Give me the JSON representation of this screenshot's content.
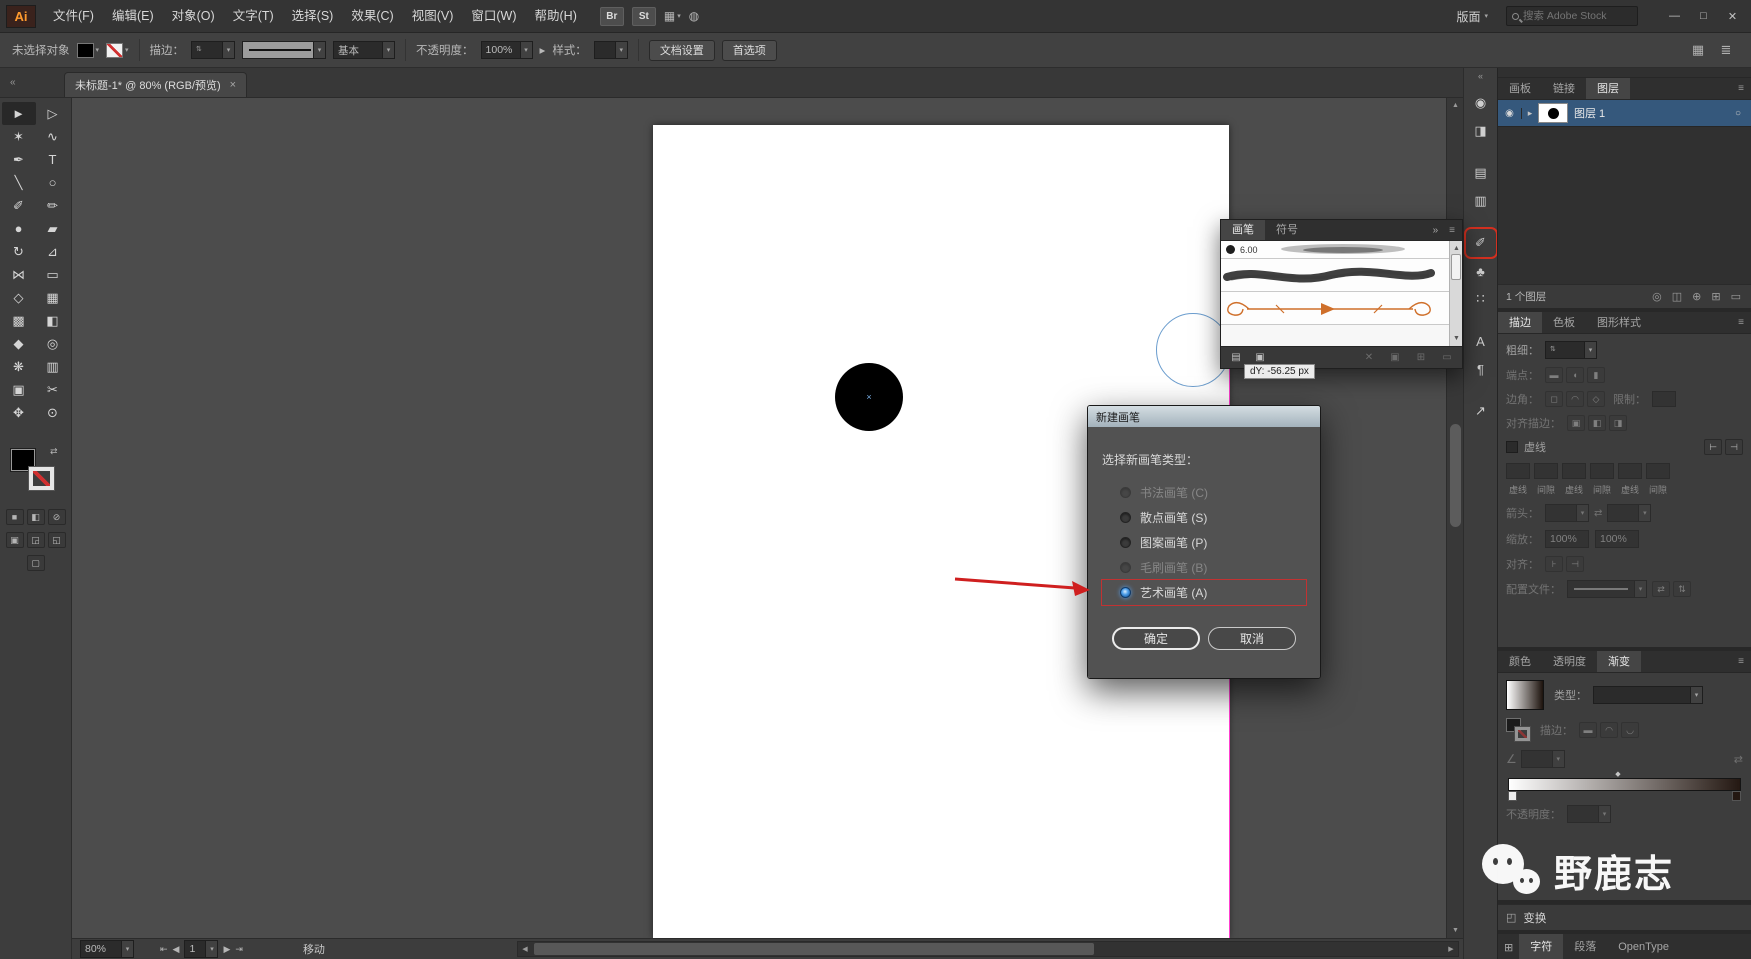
{
  "ui": {
    "caret": "▾",
    "stepper": "⇅",
    "swap": "⇄",
    "arrow_right": "▸",
    "tri_up": "▲",
    "tri_down": "▼",
    "tri_left": "◀",
    "tri_right": "▶"
  },
  "menubar": {
    "logo": "Ai",
    "items": [
      "文件(F)",
      "编辑(E)",
      "对象(O)",
      "文字(T)",
      "选择(S)",
      "效果(C)",
      "视图(V)",
      "窗口(W)",
      "帮助(H)"
    ],
    "br_label": "Br",
    "st_label": "St",
    "arrange_icon": "▦",
    "sync_icon": "◍",
    "layout_label": "版面",
    "search_placeholder": "搜索 Adobe Stock",
    "window_controls": {
      "minimize": "—",
      "maximize": "□",
      "close": "✕"
    }
  },
  "controlbar": {
    "no_selection": "未选择对象",
    "stroke_label": "描边：",
    "brush_def": "基本",
    "opacity_label": "不透明度：",
    "opacity_value": "100%",
    "style_label": "样式：",
    "doc_setup": "文档设置",
    "preferences": "首选项",
    "right_icons": [
      {
        "name": "arrange-documents-icon",
        "glyph": "▦"
      },
      {
        "name": "workspace-menu-icon",
        "glyph": "≣"
      }
    ]
  },
  "tabbar": {
    "collapse": "«",
    "doc_title": "未标题-1* @ 80% (RGB/预览)",
    "close": "×"
  },
  "toolbar": {
    "tools": [
      {
        "name": "selection-tool",
        "glyph": "►",
        "selected": true
      },
      {
        "name": "direct-selection-tool",
        "glyph": "▷"
      },
      {
        "name": "magic-wand-tool",
        "glyph": "✶"
      },
      {
        "name": "lasso-tool",
        "glyph": "∿"
      },
      {
        "name": "pen-tool",
        "glyph": "✒"
      },
      {
        "name": "type-tool",
        "glyph": "T"
      },
      {
        "name": "line-segment-tool",
        "glyph": "╲"
      },
      {
        "name": "ellipse-tool",
        "glyph": "○"
      },
      {
        "name": "paintbrush-tool",
        "glyph": "✐"
      },
      {
        "name": "pencil-tool",
        "glyph": "✏"
      },
      {
        "name": "blob-brush-tool",
        "glyph": "●"
      },
      {
        "name": "eraser-tool",
        "glyph": "▰"
      },
      {
        "name": "rotate-tool",
        "glyph": "↻"
      },
      {
        "name": "scale-tool",
        "glyph": "⊿"
      },
      {
        "name": "width-tool",
        "glyph": "⋈"
      },
      {
        "name": "free-transform-tool",
        "glyph": "▭"
      },
      {
        "name": "shape-builder-tool",
        "glyph": "◇"
      },
      {
        "name": "perspective-grid-tool",
        "glyph": "▦"
      },
      {
        "name": "mesh-tool",
        "glyph": "▩"
      },
      {
        "name": "gradient-tool",
        "glyph": "◧"
      },
      {
        "name": "eyedropper-tool",
        "glyph": "◆"
      },
      {
        "name": "blend-tool",
        "glyph": "◎"
      },
      {
        "name": "symbol-sprayer-tool",
        "glyph": "❋"
      },
      {
        "name": "column-graph-tool",
        "glyph": "▥"
      },
      {
        "name": "artboard-tool",
        "glyph": "▣"
      },
      {
        "name": "slice-tool",
        "glyph": "✂"
      },
      {
        "name": "hand-tool",
        "glyph": "✥"
      },
      {
        "name": "zoom-tool",
        "glyph": "⊙"
      }
    ],
    "swatch_icons": [
      {
        "name": "color-mode-icon",
        "glyph": "■"
      },
      {
        "name": "gradient-mode-icon",
        "glyph": "◧"
      },
      {
        "name": "none-mode-icon",
        "glyph": "⊘"
      }
    ],
    "mode_icons": [
      {
        "name": "draw-normal-icon",
        "glyph": "▣"
      },
      {
        "name": "draw-behind-icon",
        "glyph": "◲"
      },
      {
        "name": "draw-inside-icon",
        "glyph": "◱"
      }
    ],
    "screen_mode_icon": "▢"
  },
  "canvas": {
    "center_mark": "×",
    "tooltip": "dY: -56.25 px"
  },
  "right_strip": {
    "collapse": "«",
    "icons": [
      {
        "name": "color-guide-icon",
        "glyph": "◉"
      },
      {
        "name": "swatches-icon",
        "glyph": "◨"
      },
      {
        "name": "stroke-panel-icon",
        "glyph": "▤",
        "gap": true
      },
      {
        "name": "graphic-styles-icon",
        "glyph": "▥"
      },
      {
        "name": "brushes-panel-icon",
        "glyph": "✐",
        "gap": true,
        "boxed": true
      },
      {
        "name": "symbols-panel-icon",
        "glyph": "♣"
      },
      {
        "name": "glyphs-panel-icon",
        "glyph": "∷"
      },
      {
        "name": "appearance-panel-icon",
        "glyph": "A",
        "gap": true
      },
      {
        "name": "paragraph-panel-icon",
        "glyph": "¶"
      },
      {
        "name": "export-panel-icon",
        "glyph": "↗",
        "gap": true
      }
    ]
  },
  "dock": {
    "panel_menu_icon": "≡",
    "layers_tabs": [
      {
        "name": "tab-artboards",
        "label": "画板"
      },
      {
        "name": "tab-links",
        "label": "链接"
      },
      {
        "name": "tab-layers",
        "label": "图层",
        "active": true
      }
    ],
    "layers": {
      "eye_icon": "◉",
      "expand_icon": "▸",
      "layer_name": "图层 1",
      "target_icon": "○",
      "count_label": "1 个图层",
      "bottom_icons": [
        {
          "name": "locate-object-icon",
          "glyph": "◎"
        },
        {
          "name": "make-clip-mask-icon",
          "glyph": "◫"
        },
        {
          "name": "new-sublayer-icon",
          "glyph": "⊕"
        },
        {
          "name": "new-layer-icon",
          "glyph": "⊞"
        },
        {
          "name": "delete-layer-icon",
          "glyph": "▭"
        }
      ]
    },
    "stroke_tabs": [
      {
        "name": "tab-stroke",
        "label": "描边",
        "active": true
      },
      {
        "name": "tab-swatches",
        "label": "色板"
      },
      {
        "name": "tab-graphic-styles",
        "label": "图形样式"
      }
    ],
    "stroke": {
      "weight_label": "粗细：",
      "cap_label": "端点：",
      "cap_icons": [
        {
          "name": "butt-cap-icon",
          "glyph": "▬"
        },
        {
          "name": "round-cap-icon",
          "glyph": "◖"
        },
        {
          "name": "projecting-cap-icon",
          "glyph": "▮"
        }
      ],
      "corner_label": "边角：",
      "corner_icons": [
        {
          "name": "miter-join-icon",
          "glyph": "◻"
        },
        {
          "name": "round-join-icon",
          "glyph": "◠"
        },
        {
          "name": "bevel-join-icon",
          "glyph": "◇"
        }
      ],
      "limit_label": "限制：",
      "align_label": "对齐描边：",
      "align_icons": [
        {
          "name": "align-stroke-center-icon",
          "glyph": "▣"
        },
        {
          "name": "align-stroke-inside-icon",
          "glyph": "◧"
        },
        {
          "name": "align-stroke-outside-icon",
          "glyph": "◨"
        }
      ],
      "dashed_label": "虚线",
      "dash_btn_icons": [
        {
          "name": "preserve-dash-icon",
          "glyph": "⊢"
        },
        {
          "name": "align-dash-icon",
          "glyph": "⊣"
        }
      ],
      "dash_field_labels": [
        "虚线",
        "间隙",
        "虚线",
        "间隙",
        "虚线",
        "间隙"
      ],
      "arrow_label": "箭头：",
      "swap_icon": "⇄",
      "scale_label": "缩放：",
      "scale_values": [
        "100%",
        "100%"
      ],
      "align2_label": "对齐：",
      "align2_icons": [
        {
          "name": "arrow-align-tip-icon",
          "glyph": "⊦"
        },
        {
          "name": "arrow-align-end-icon",
          "glyph": "⊣"
        }
      ],
      "profile_label": "配置文件：",
      "flip_icons": [
        {
          "name": "flip-along-icon",
          "glyph": "⇄"
        },
        {
          "name": "flip-across-icon",
          "glyph": "⇅"
        }
      ]
    },
    "gradient_tabs": [
      {
        "name": "tab-color",
        "label": "颜色"
      },
      {
        "name": "tab-transparency",
        "label": "透明度"
      },
      {
        "name": "tab-gradient",
        "label": "渐变",
        "active": true
      }
    ],
    "gradient": {
      "type_label": "类型：",
      "stroke_label": "描边：",
      "stroke_icons": [
        {
          "name": "gradient-within-stroke-icon",
          "glyph": "▬"
        },
        {
          "name": "gradient-along-stroke-icon",
          "glyph": "◠"
        },
        {
          "name": "gradient-across-stroke-icon",
          "glyph": "◡"
        }
      ],
      "angle_icon": "∠",
      "reverse_icon": "⇄",
      "opacity_label": "不透明度："
    },
    "transform_icon": "◰",
    "transform_label": "变换",
    "type_icon": "⊞",
    "type_tabs": [
      {
        "name": "tab-character",
        "label": "字符",
        "active": true
      },
      {
        "name": "tab-paragraph",
        "label": "段落"
      },
      {
        "name": "tab-opentype",
        "label": "OpenType"
      }
    ]
  },
  "brushes_panel": {
    "tabs": [
      {
        "name": "tab-brushes",
        "label": "画笔",
        "active": true
      },
      {
        "name": "tab-symbols",
        "label": "符号"
      }
    ],
    "chevrons": "»",
    "menu_icon": "≡",
    "brush_name": "6.00",
    "footer_left": [
      {
        "name": "brush-libraries-icon",
        "glyph": "▤"
      },
      {
        "name": "libraries-panel-icon",
        "glyph": "▣"
      }
    ],
    "footer_right": [
      {
        "name": "remove-brush-stroke-icon",
        "glyph": "✕",
        "disabled": true
      },
      {
        "name": "brush-options-icon",
        "glyph": "▣",
        "disabled": true
      },
      {
        "name": "new-brush-icon",
        "glyph": "⊞",
        "disabled": true
      },
      {
        "name": "delete-brush-icon",
        "glyph": "▭",
        "disabled": true
      }
    ]
  },
  "dialog": {
    "title": "新建画笔",
    "prompt": "选择新画笔类型：",
    "options": [
      {
        "name": "radio-calligraphic-brush",
        "label": "书法画笔 (C)",
        "disabled": true
      },
      {
        "name": "radio-scatter-brush",
        "label": "散点画笔 (S)"
      },
      {
        "name": "radio-pattern-brush",
        "label": "图案画笔 (P)"
      },
      {
        "name": "radio-bristle-brush",
        "label": "毛刷画笔 (B)",
        "disabled": true
      },
      {
        "name": "radio-art-brush",
        "label": "艺术画笔 (A)",
        "selected": true,
        "highlighted": true
      }
    ],
    "ok_label": "确定",
    "cancel_label": "取消"
  },
  "statusbar": {
    "zoom": "80%",
    "nav_first": "⇤",
    "nav_prev": "◀",
    "artboard_num": "1",
    "nav_next": "▶",
    "nav_last": "⇥",
    "tool": "移动"
  },
  "watermark": {
    "text": "野鹿志"
  }
}
